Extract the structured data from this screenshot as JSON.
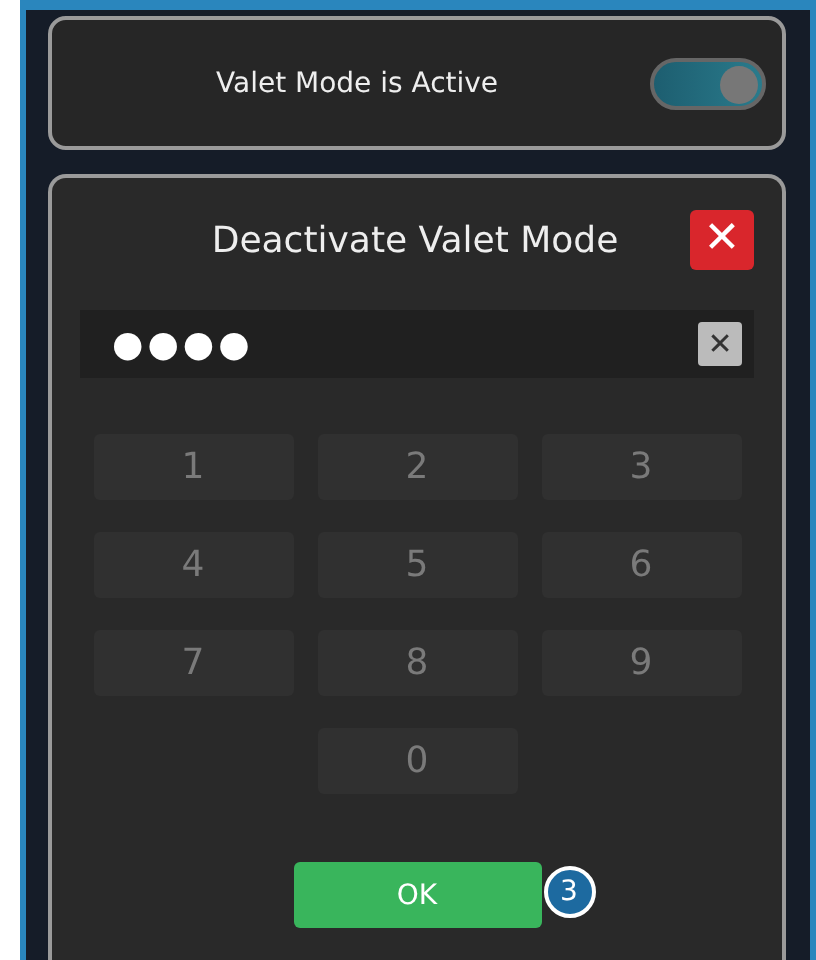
{
  "status_card": {
    "label": "Valet Mode is Active",
    "toggle": {
      "on": true
    }
  },
  "dialog": {
    "title": "Deactivate Valet Mode",
    "close_button": {
      "label": "✕"
    },
    "pin_field": {
      "value": "●●●●"
    },
    "clear_button": {
      "label": "✕"
    },
    "keys": [
      {
        "label": "1",
        "disabled": true
      },
      {
        "label": "2",
        "disabled": true
      },
      {
        "label": "3",
        "disabled": true
      },
      {
        "label": "4",
        "disabled": true
      },
      {
        "label": "5",
        "disabled": true
      },
      {
        "label": "6",
        "disabled": true
      },
      {
        "label": "7",
        "disabled": true
      },
      {
        "label": "8",
        "disabled": true
      },
      {
        "label": "9",
        "disabled": true
      },
      {
        "label": "0",
        "disabled": true
      }
    ],
    "ok_button": {
      "label": "OK"
    },
    "step_badge": "3"
  }
}
